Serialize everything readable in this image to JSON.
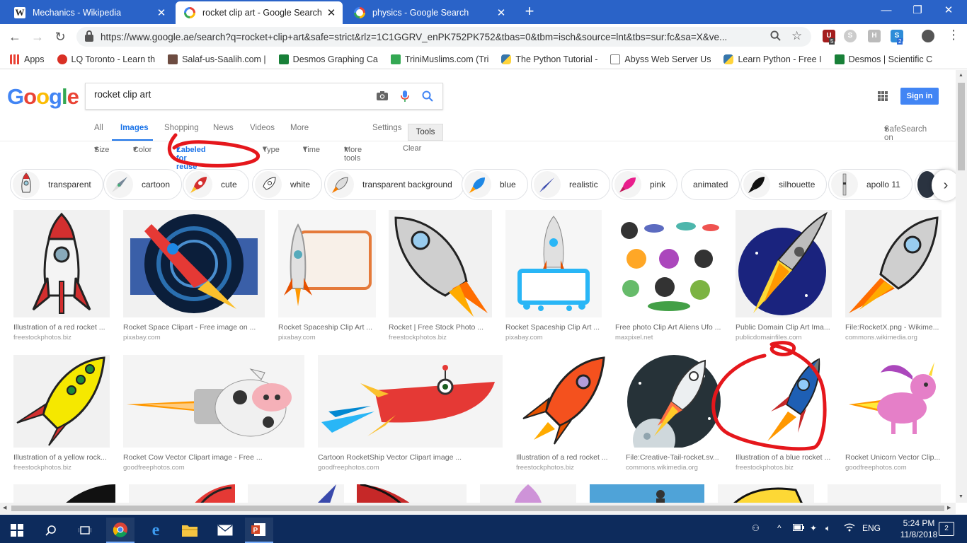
{
  "browser": {
    "tabs": [
      {
        "title": "Mechanics - Wikipedia",
        "icon": "wikipedia-icon"
      },
      {
        "title": "rocket clip art - Google Search",
        "icon": "google-icon"
      },
      {
        "title": "physics - Google Search",
        "icon": "google-icon"
      }
    ],
    "url": "https://www.google.ae/search?q=rocket+clip+art&safe=strict&rlz=1C1GGRV_enPK752PK752&tbas=0&tbm=isch&source=lnt&tbs=sur:fc&sa=X&ve...",
    "extension_badges": {
      "ublock": "5",
      "skype": "2"
    }
  },
  "bookmarks": [
    {
      "label": "Apps",
      "color": "#e94235"
    },
    {
      "label": "LQ Toronto - Learn th",
      "color": "#d93025"
    },
    {
      "label": "Salaf-us-Saalih.com |",
      "color": "#6d4c41"
    },
    {
      "label": "Desmos Graphing Ca",
      "color": "#188038"
    },
    {
      "label": "TriniMuslims.com (Tri",
      "color": "#34a853"
    },
    {
      "label": "The Python Tutorial -",
      "color": "#3776ab"
    },
    {
      "label": "Abyss Web Server Us",
      "color": "#9aa0a6"
    },
    {
      "label": "Learn Python - Free I",
      "color": "#3776ab"
    },
    {
      "label": "Desmos | Scientific C",
      "color": "#188038"
    }
  ],
  "google": {
    "query": "rocket clip art",
    "sign_in": "Sign in",
    "safesearch": "SafeSearch on",
    "tabs": [
      "All",
      "Images",
      "Shopping",
      "News",
      "Videos",
      "More"
    ],
    "settings": "Settings",
    "tools": "Tools",
    "filters": [
      "Size",
      "Color",
      "Labeled for reuse",
      "Type",
      "Time",
      "More tools",
      "Clear"
    ],
    "chips": [
      "transparent",
      "cartoon",
      "cute",
      "white",
      "transparent background",
      "blue",
      "realistic",
      "pink",
      "animated",
      "silhouette",
      "apollo 11"
    ],
    "results_row1": [
      {
        "caption": "Illustration of a red rocket ...",
        "source": "freestockphotos.biz"
      },
      {
        "caption": "Rocket Space Clipart - Free image on ...",
        "source": "pixabay.com"
      },
      {
        "caption": "Rocket Spaceship Clip Art ...",
        "source": "pixabay.com"
      },
      {
        "caption": "Rocket | Free Stock Photo ...",
        "source": "freestockphotos.biz"
      },
      {
        "caption": "Rocket Spaceship Clip Art ...",
        "source": "pixabay.com"
      },
      {
        "caption": "Free photo Clip Art Aliens Ufo ...",
        "source": "maxpixel.net"
      },
      {
        "caption": "Public Domain Clip Art Ima...",
        "source": "publicdomainfiles.com"
      },
      {
        "caption": "File:RocketX.png - Wikime...",
        "source": "commons.wikimedia.org"
      }
    ],
    "results_row2": [
      {
        "caption": "Illustration of a yellow rock...",
        "source": "freestockphotos.biz"
      },
      {
        "caption": "Rocket Cow Vector Clipart image - Free ...",
        "source": "goodfreephotos.com"
      },
      {
        "caption": "Cartoon RocketShip Vector Clipart image ...",
        "source": "goodfreephotos.com"
      },
      {
        "caption": "Illustration of a red rocket ...",
        "source": "freestockphotos.biz"
      },
      {
        "caption": "File:Creative-Tail-rocket.sv...",
        "source": "commons.wikimedia.org"
      },
      {
        "caption": "Illustration of a blue rocket ...",
        "source": "freestockphotos.biz"
      },
      {
        "caption": "Rocket Unicorn Vector Clip...",
        "source": "goodfreephotos.com"
      }
    ]
  },
  "taskbar": {
    "language": "ENG",
    "time": "5:24 PM",
    "date": "11/8/2018",
    "notifications": "2"
  }
}
